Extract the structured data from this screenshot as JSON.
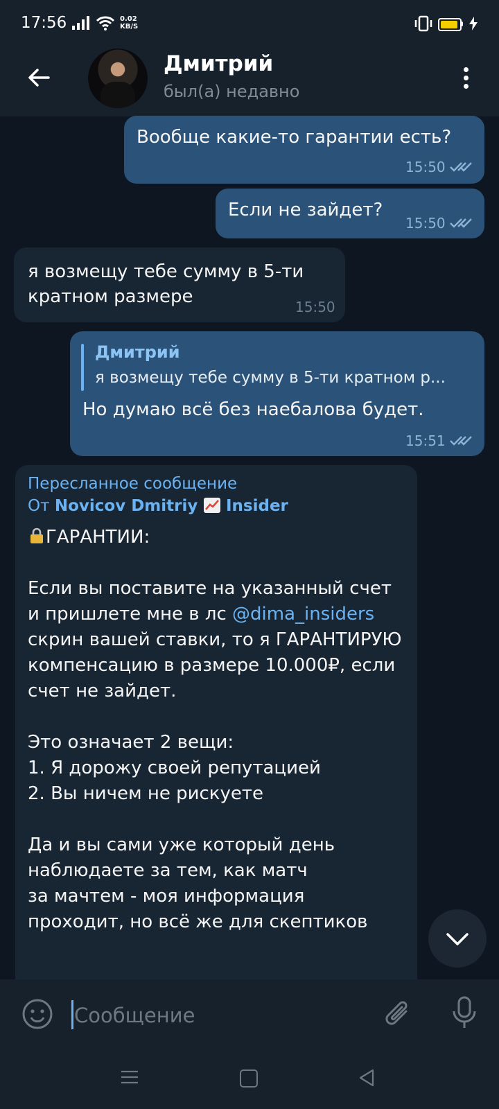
{
  "status_bar": {
    "time": "17:56",
    "network_speed_value": "0.02",
    "network_speed_unit": "KB/S"
  },
  "header": {
    "contact_name": "Дмитрий",
    "contact_status": "был(а) недавно"
  },
  "messages": [
    {
      "direction": "out",
      "text": "Вообще какие-то гарантии есть?",
      "time": "15:50",
      "read": true
    },
    {
      "direction": "out",
      "text": "Если не зайдет?",
      "time": "15:50",
      "read": true
    },
    {
      "direction": "in",
      "lines": [
        "я возмещу тебе сумму в 5-ти",
        "кратном размере"
      ],
      "time": "15:50"
    },
    {
      "direction": "out",
      "reply_to": {
        "name": "Дмитрий",
        "text": "я возмещу тебе сумму в 5-ти кратном р..."
      },
      "text": "Но думаю всё без наебалова будет.",
      "time": "15:51",
      "read": true
    },
    {
      "direction": "in",
      "forwarded_label": "Пересланное сообщение",
      "forwarded_prefix": "От",
      "forwarded_from": "Novicov Dmitriy",
      "forwarded_from_suffix": "Insider",
      "heading": "ГАРАНТИИ:",
      "para1_before_link": "Если вы поставите на указанный счет  и пришлете мне в лс",
      "link": "@dima_insiders",
      "para1_after_link": "скрин вашей ставки, то я ГАРАНТИРУЮ компенсацию в размере 10.000₽, если счет не зайдет.",
      "para2_lines": [
        "Это означает 2 вещи:",
        "1. Я дорожу своей репутацией",
        "2. Вы ничем не рискуете"
      ],
      "para3_lines": [
        "Да и вы сами уже который день",
        "наблюдаете за тем, как матч",
        "за мачтем - моя информация",
        "проходит, но всё же для скептиков"
      ]
    }
  ],
  "input": {
    "placeholder": "Сообщение"
  },
  "colors": {
    "background": "#0e1621",
    "header": "#17212b",
    "outgoing_bubble": "#2b5278",
    "incoming_bubble": "#182533",
    "accent": "#6ab2f2"
  },
  "icons": [
    "back-arrow-icon",
    "more-vert-icon",
    "double-check-icon",
    "lock-icon",
    "chart-up-icon",
    "chevron-down-icon",
    "emoji-icon",
    "paperclip-icon",
    "microphone-icon"
  ]
}
